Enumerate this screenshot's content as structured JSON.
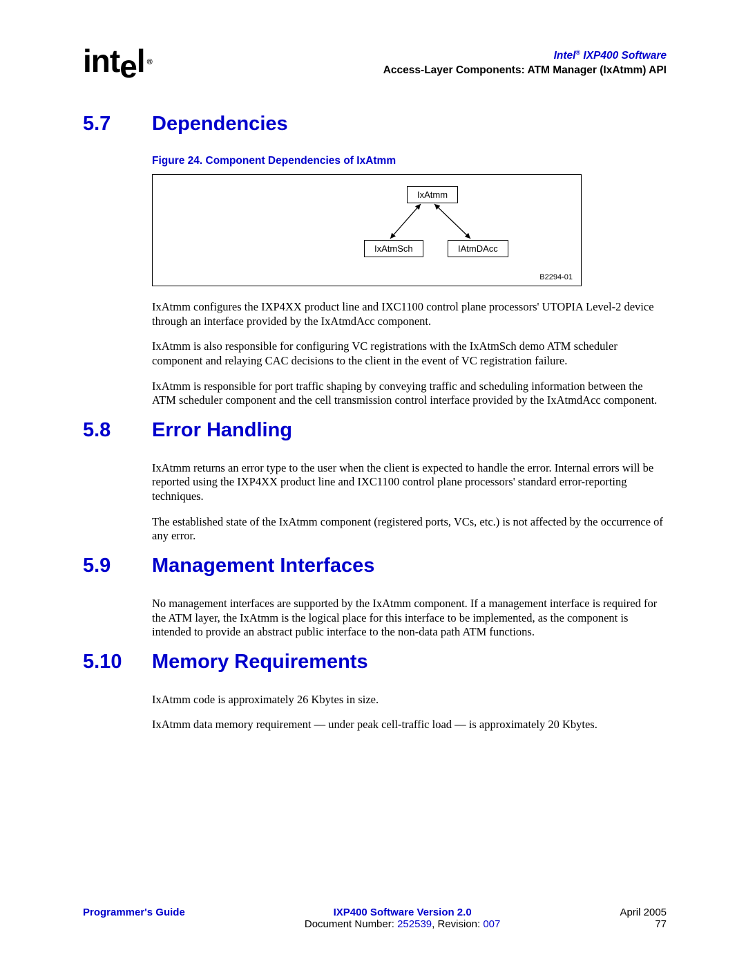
{
  "header": {
    "product_line1_a": "Intel",
    "product_line1_b": " IXP400 Software",
    "product_line2": "Access-Layer Components: ATM Manager (IxAtmm) API",
    "logo_reg": "®",
    "logo_sup": "®"
  },
  "sections": {
    "s57": {
      "num": "5.7",
      "title": "Dependencies"
    },
    "s58": {
      "num": "5.8",
      "title": "Error Handling"
    },
    "s59": {
      "num": "5.9",
      "title": "Management Interfaces"
    },
    "s510": {
      "num": "5.10",
      "title": "Memory Requirements"
    }
  },
  "figure": {
    "caption": "Figure 24. Component Dependencies of IxAtmm",
    "top": "IxAtmm",
    "bl": "IxAtmSch",
    "br": "IAtmDAcc",
    "code": "B2294-01"
  },
  "paragraphs": {
    "p1": "IxAtmm configures the IXP4XX product line and IXC1100 control plane processors' UTOPIA Level-2 device through an interface provided by the IxAtmdAcc component.",
    "p2": "IxAtmm is also responsible for configuring VC registrations with the IxAtmSch demo ATM scheduler component and relaying CAC decisions to the client in the event of VC registration failure.",
    "p3": "IxAtmm is responsible for port traffic shaping by conveying traffic and scheduling information between the ATM scheduler component and the cell transmission control interface provided by the IxAtmdAcc component.",
    "p4": "IxAtmm returns an error type to the user when the client is expected to handle the error. Internal errors will be reported using the IXP4XX product line and IXC1100 control plane processors' standard error-reporting techniques.",
    "p5": "The established state of the IxAtmm component (registered ports, VCs, etc.) is not affected by the occurrence of any error.",
    "p6": "No management interfaces are supported by the IxAtmm component. If a management interface is required for the ATM layer, the IxAtmm is the logical place for this interface to be implemented, as the component is intended to provide an abstract public interface to the non-data path ATM functions.",
    "p7": "IxAtmm code is approximately 26 Kbytes in size.",
    "p8": "IxAtmm data memory requirement — under peak cell-traffic load — is approximately 20 Kbytes."
  },
  "footer": {
    "left": "Programmer's Guide",
    "center1": "IXP400 Software Version 2.0",
    "center2a": "Document Number: ",
    "center2b": "252539",
    "center2c": ", Revision: ",
    "center2d": "007",
    "right_date": "April 2005",
    "right_page": "77"
  }
}
